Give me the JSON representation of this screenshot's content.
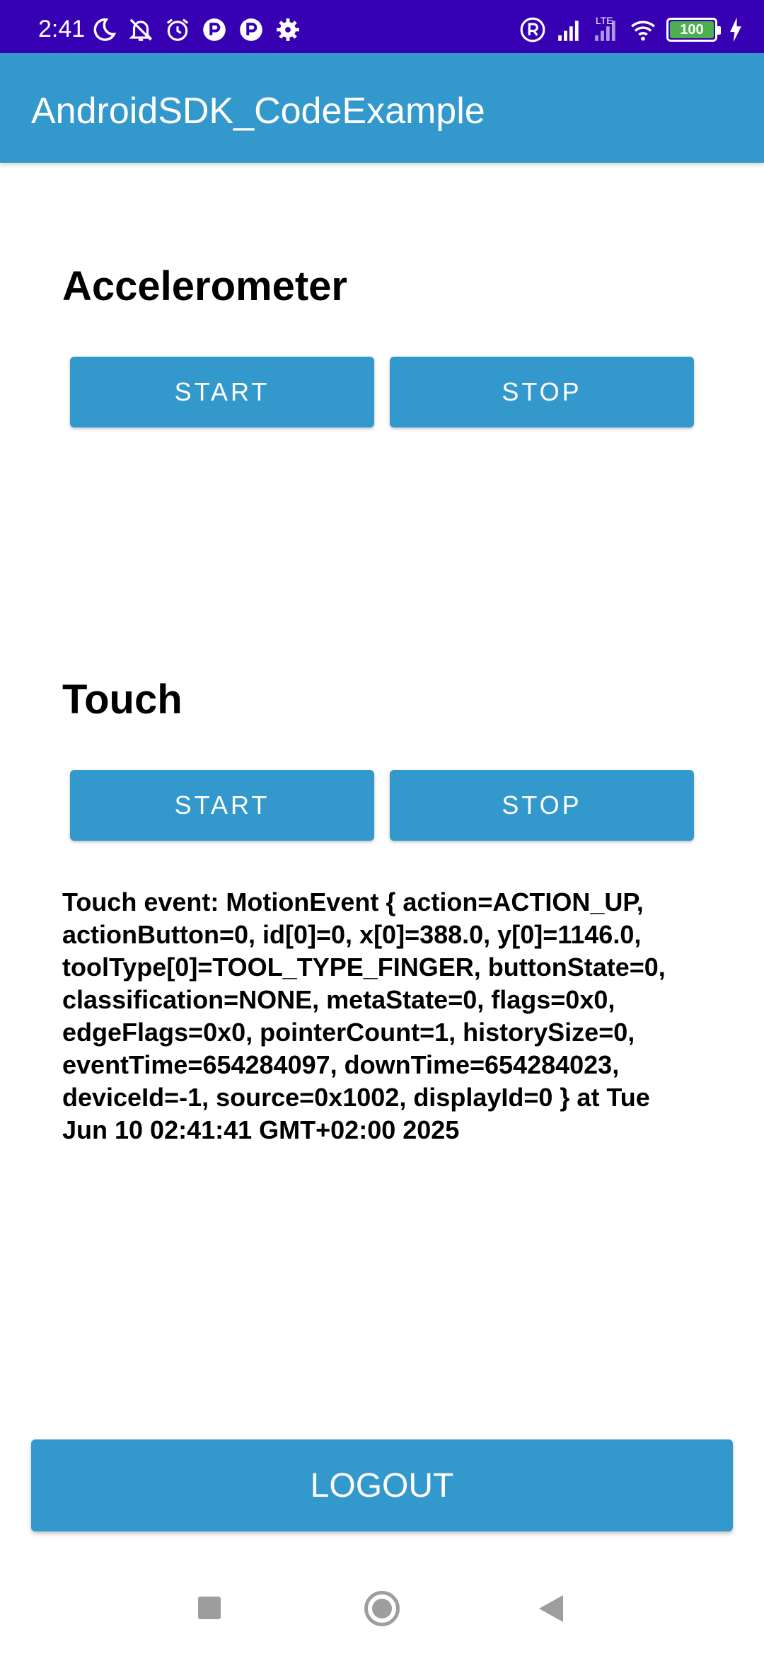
{
  "status_bar": {
    "time": "2:41",
    "battery": "100",
    "network": "LTE",
    "left_icons": [
      "moon-icon",
      "bell-off-icon",
      "alarm-icon",
      "app-notification-icon",
      "app-notification-icon",
      "gear-icon"
    ],
    "right_icons": [
      "registered-icon",
      "signal-icon",
      "lte-signal-icon",
      "wifi-icon",
      "battery-icon",
      "charging-icon"
    ],
    "colors": {
      "background": "#3700b3",
      "battery_fill": "#4caf50"
    }
  },
  "app_bar": {
    "title": "AndroidSDK_CodeExample",
    "color": "#3399cc"
  },
  "accelerometer": {
    "title": "Accelerometer",
    "start_label": "START",
    "stop_label": "STOP"
  },
  "touch": {
    "title": "Touch",
    "start_label": "START",
    "stop_label": "STOP",
    "output": "Touch event: MotionEvent { action=ACTION_UP, actionButton=0, id[0]=0, x[0]=388.0, y[0]=1146.0, toolType[0]=TOOL_TYPE_FINGER, buttonState=0, classification=NONE, metaState=0, flags=0x0, edgeFlags=0x0, pointerCount=1, historySize=0, eventTime=654284097, downTime=654284023, deviceId=-1, source=0x1002, displayId=0 } at Tue Jun 10 02:41:41 GMT+02:00 2025"
  },
  "logout_label": "LOGOUT",
  "nav_bar": {
    "icons": [
      "recents-icon",
      "home-icon",
      "back-icon"
    ]
  }
}
